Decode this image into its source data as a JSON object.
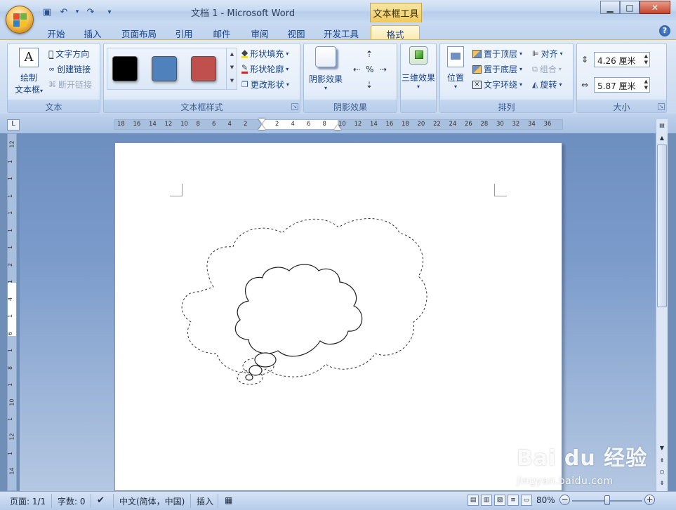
{
  "window": {
    "title": "文档 1 - Microsoft Word",
    "context_tab_header": "文本框工具",
    "controls": {
      "minimize": "▁",
      "maximize": "□",
      "close": "✕"
    }
  },
  "qat": {
    "save": "▣",
    "undo": "↶",
    "undo_dd": "▾",
    "redo": "↷",
    "customize": "▾"
  },
  "tabs": [
    {
      "label": "开始",
      "active": false
    },
    {
      "label": "插入",
      "active": false
    },
    {
      "label": "页面布局",
      "active": false
    },
    {
      "label": "引用",
      "active": false
    },
    {
      "label": "邮件",
      "active": false
    },
    {
      "label": "审阅",
      "active": false
    },
    {
      "label": "视图",
      "active": false
    },
    {
      "label": "开发工具",
      "active": false
    },
    {
      "label": "格式",
      "active": true
    }
  ],
  "help": "?",
  "ribbon": {
    "text_group": {
      "label": "文本",
      "draw_textbox_line1": "绘制",
      "draw_textbox_line2": "文本框",
      "text_direction": "文字方向",
      "create_link": "创建链接",
      "break_link": "断开链接"
    },
    "textbox_styles": {
      "label": "文本框样式",
      "swatch_colors": [
        "#000000",
        "#4f81bd",
        "#c0504d"
      ],
      "shape_fill": "形状填充",
      "shape_outline": "形状轮廓",
      "change_shape": "更改形状"
    },
    "shadow": {
      "label": "阴影效果",
      "button": "阴影效果"
    },
    "threed": {
      "label": "",
      "button": "三维效果"
    },
    "arrange": {
      "label": "排列",
      "position": "位置",
      "bring_front": "置于顶层",
      "send_back": "置于底层",
      "text_wrap": "文字环绕",
      "align": "对齐",
      "group": "组合",
      "rotate": "旋转"
    },
    "size": {
      "label": "大小",
      "height": "4.26 厘米",
      "width": "5.87 厘米"
    }
  },
  "hruler_ticks": [
    "18",
    "16",
    "14",
    "12",
    "10",
    "8",
    "6",
    "4",
    "2",
    "",
    "2",
    "4",
    "6",
    "8",
    "10",
    "12",
    "14",
    "16",
    "18",
    "20",
    "22",
    "24",
    "26",
    "28",
    "30",
    "32",
    "34",
    "36"
  ],
  "vruler_ticks": [
    "12",
    "1",
    "1",
    "1",
    "1",
    "1",
    "1",
    "2",
    "1",
    "4",
    "1",
    "6",
    "1",
    "8",
    "1",
    "10",
    "1",
    "12",
    "1",
    "14"
  ],
  "ruler_corner": "L",
  "status": {
    "page": "页面: 1/1",
    "words": "字数: 0",
    "language": "中文(简体，中国)",
    "mode": "插入",
    "zoom": "80%",
    "zoom_fraction": 0.5
  },
  "watermark": {
    "main": "Bai du 经验",
    "sub": "jingyan.baidu.com"
  }
}
